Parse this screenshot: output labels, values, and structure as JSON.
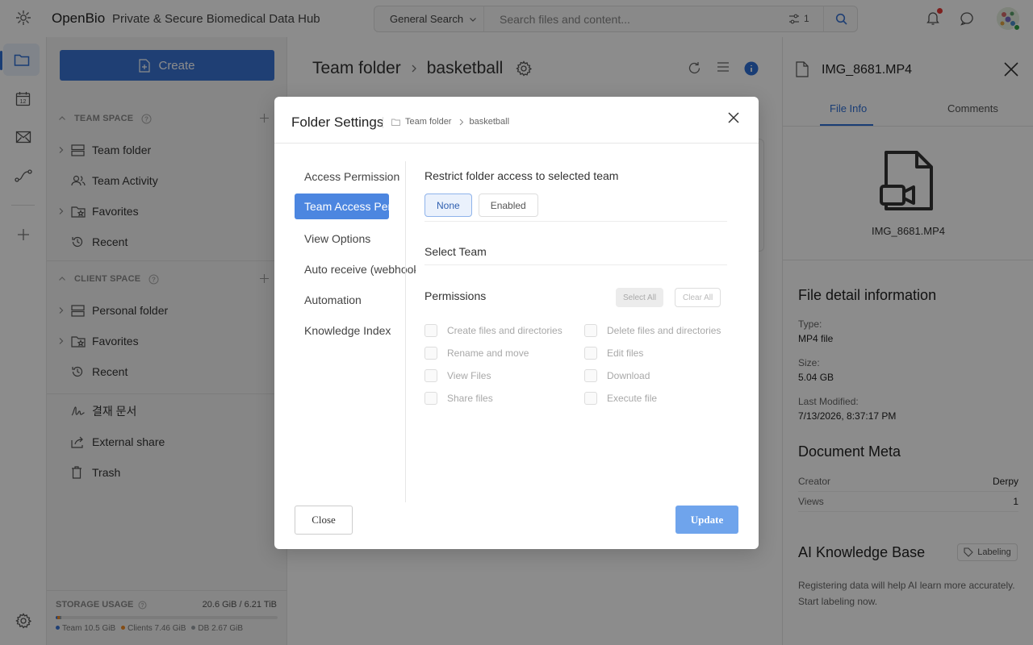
{
  "app": {
    "name": "OpenBio",
    "tagline": "Private & Secure Biomedical Data Hub"
  },
  "search": {
    "scope": "General Search",
    "placeholder": "Search files and content...",
    "filter_count": "1"
  },
  "sidebar": {
    "create_label": "Create",
    "team_space": {
      "title": "TEAM SPACE",
      "items": [
        "Team folder",
        "Team Activity",
        "Favorites",
        "Recent"
      ]
    },
    "client_space": {
      "title": "CLIENT SPACE",
      "items": [
        "Personal folder",
        "Favorites",
        "Recent"
      ]
    },
    "extra_items": [
      "결재 문서",
      "External share",
      "Trash"
    ],
    "storage": {
      "title": "STORAGE USAGE",
      "total": "20.6 GiB / 6.21 TiB",
      "legend": [
        {
          "label": "Team",
          "value": "10.5 GiB",
          "color": "#3a74d4"
        },
        {
          "label": "Clients",
          "value": "7.46 GiB",
          "color": "#f08a24"
        },
        {
          "label": "DB",
          "value": "2.67 GiB",
          "color": "#9aa0a6"
        }
      ],
      "fractions": [
        0.0017,
        0.0012,
        0.0004
      ]
    }
  },
  "main": {
    "breadcrumb": [
      "Team folder",
      "basketball"
    ]
  },
  "right_panel": {
    "title": "IMG_8681.MP4",
    "tabs": [
      "File Info",
      "Comments"
    ],
    "active_tab": "File Info",
    "file_name": "IMG_8681.MP4",
    "detail_heading": "File detail information",
    "type_label": "Type:",
    "type_value": "MP4 file",
    "size_label": "Size:",
    "size_value": "5.04 GB",
    "modified_label": "Last Modified:",
    "modified_value": "7/13/2026, 8:37:17 PM",
    "meta_heading": "Document Meta",
    "creator_label": "Creator",
    "creator_value": "Derpy",
    "views_label": "Views",
    "views_value": "1",
    "ai_heading": "AI Knowledge Base",
    "labeling_button": "Labeling",
    "ai_note": "Registering data will help AI learn more accurately. Start labeling now."
  },
  "modal": {
    "title": "Folder Settings",
    "breadcrumb": [
      "Team folder",
      "basketball"
    ],
    "nav": [
      "Access Permission",
      "Team Access Permission",
      "View Options",
      "Auto receive (webhook)",
      "Automation",
      "Knowledge Index"
    ],
    "active_nav": "Team Access Permission",
    "restrict_title": "Restrict folder access to selected team",
    "restrict_options": [
      "None",
      "Enabled"
    ],
    "restrict_selected": "None",
    "select_team_title": "Select Team",
    "permissions_title": "Permissions",
    "select_all": "Select All",
    "clear_all": "Clear All",
    "permissions": [
      "Create files and directories",
      "Delete files and directories",
      "Rename and move",
      "Edit files",
      "View Files",
      "Download",
      "Share files",
      "Execute file"
    ],
    "close_label": "Close",
    "update_label": "Update"
  },
  "colors": {
    "accent": "#3a74d4",
    "overlay": "rgba(0,0,0,0.45)",
    "update_button": "#6fa4ec"
  }
}
